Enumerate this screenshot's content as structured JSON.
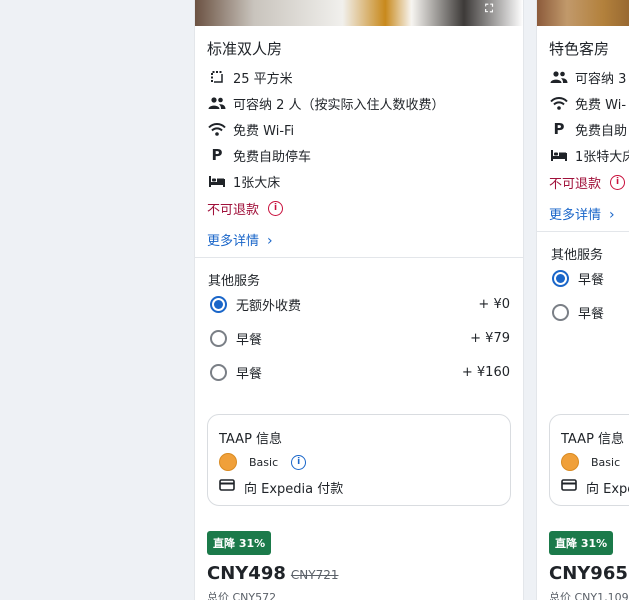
{
  "colors": {
    "accent": "#1a66c9",
    "warning": "#a0103a",
    "deal": "#1b7a4a",
    "tier": "#f0a03a"
  },
  "cards": [
    {
      "name": "标准双人房",
      "features": [
        {
          "icon": "area-icon",
          "text": "25 平方米"
        },
        {
          "icon": "guests-icon",
          "text": "可容纳 2 人（按实际入住人数收费）"
        },
        {
          "icon": "wifi-icon",
          "text": "免费 Wi-Fi"
        },
        {
          "icon": "parking-icon",
          "text": "免费自助停车"
        },
        {
          "icon": "bed-icon",
          "text": "1张大床"
        }
      ],
      "refund": "不可退款",
      "more_link": "更多详情",
      "services_title": "其他服务",
      "options": [
        {
          "label": "无额外收费",
          "price": "+ ¥0",
          "selected": true
        },
        {
          "label": "早餐",
          "price": "+ ¥79",
          "selected": false
        },
        {
          "label": "早餐",
          "price": "+ ¥160",
          "selected": false
        }
      ],
      "taap": {
        "title": "TAAP 信息",
        "tier": "Basic",
        "pay": "向 Expedia 付款"
      },
      "deal_badge": "直降 31%",
      "price": "CNY498",
      "old_price": "CNY721",
      "total": "总价 CNY572"
    },
    {
      "name": "特色客房",
      "features": [
        {
          "icon": "guests-icon",
          "text": "可容纳 3"
        },
        {
          "icon": "wifi-icon",
          "text": "免费 Wi-"
        },
        {
          "icon": "parking-icon",
          "text": "免费自助"
        },
        {
          "icon": "bed-icon",
          "text": "1张特大床"
        }
      ],
      "refund": "不可退款",
      "more_link": "更多详情",
      "services_title": "其他服务",
      "options": [
        {
          "label": "早餐",
          "selected": true
        },
        {
          "label": "早餐",
          "selected": false
        }
      ],
      "taap": {
        "title": "TAAP 信息",
        "tier": "Basic",
        "pay": "向 Expe"
      },
      "deal_badge": "直降 31%",
      "price": "CNY965",
      "total": "总价 CNY1,109"
    }
  ]
}
